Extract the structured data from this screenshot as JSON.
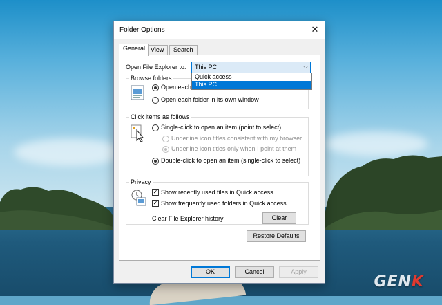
{
  "dialog": {
    "title": "Folder Options"
  },
  "tabs": [
    {
      "label": "General",
      "active": true
    },
    {
      "label": "View",
      "active": false
    },
    {
      "label": "Search",
      "active": false
    }
  ],
  "open_to": {
    "label": "Open File Explorer to:",
    "value": "This PC",
    "options": [
      {
        "label": "Quick access",
        "selected": false
      },
      {
        "label": "This PC",
        "selected": true
      }
    ]
  },
  "browse": {
    "title": "Browse folders",
    "option1": "Open each folder in the same window",
    "option2": "Open each folder in its own window"
  },
  "click_items": {
    "title": "Click items as follows",
    "single": "Single-click to open an item (point to select)",
    "underline1": "Underline icon titles consistent with my browser",
    "underline2": "Underline icon titles only when I point at them",
    "double": "Double-click to open an item (single-click to select)"
  },
  "privacy": {
    "title": "Privacy",
    "recent": "Show recently used files in Quick access",
    "frequent": "Show frequently used folders in Quick access",
    "clear_label": "Clear File Explorer history",
    "clear_button": "Clear"
  },
  "restore_button": "Restore Defaults",
  "footer": {
    "ok": "OK",
    "cancel": "Cancel",
    "apply": "Apply"
  },
  "watermark": {
    "main": "GEN",
    "accent": "K"
  },
  "colors": {
    "accent": "#0078d7",
    "dialog_bg": "#f0f0f0"
  }
}
